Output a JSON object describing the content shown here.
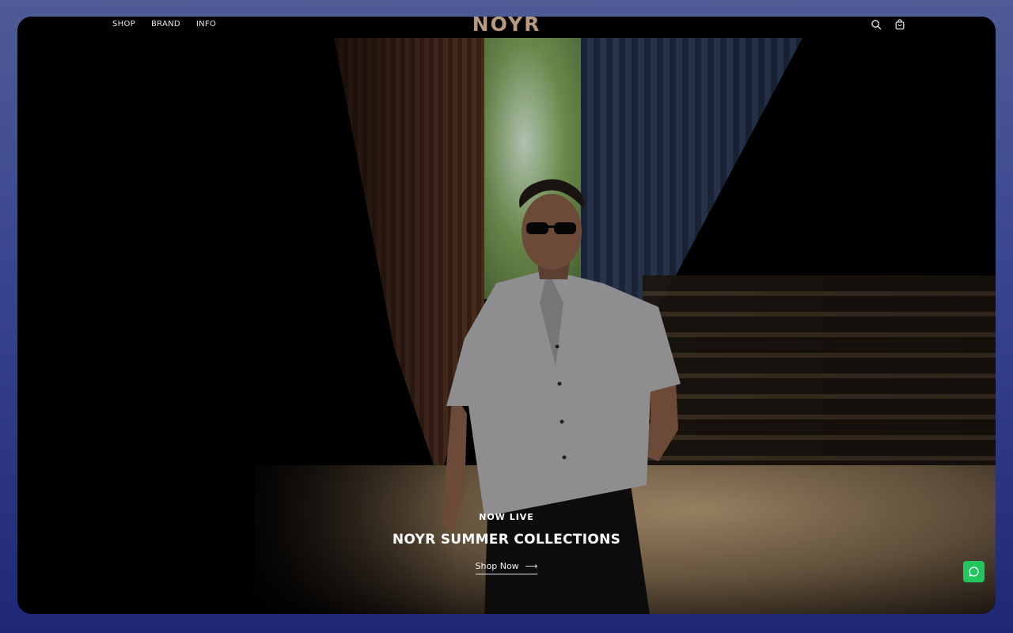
{
  "header": {
    "nav_left": [
      "SHOP",
      "BRAND",
      "INFO"
    ],
    "logo": "NOYR",
    "icons": [
      "search-icon",
      "cart-icon"
    ]
  },
  "hero": {
    "kicker": "NOW LIVE",
    "headline": "NOYR SUMMER COLLECTIONS",
    "cta_label": "Shop Now",
    "cta_arrow": "⟶"
  },
  "widgets": {
    "chat_icon": "whatsapp-chat-icon"
  },
  "colors": {
    "logo": "#b79a7e",
    "outer_background": "#2f3a88",
    "chat_button": "#23c55e"
  }
}
